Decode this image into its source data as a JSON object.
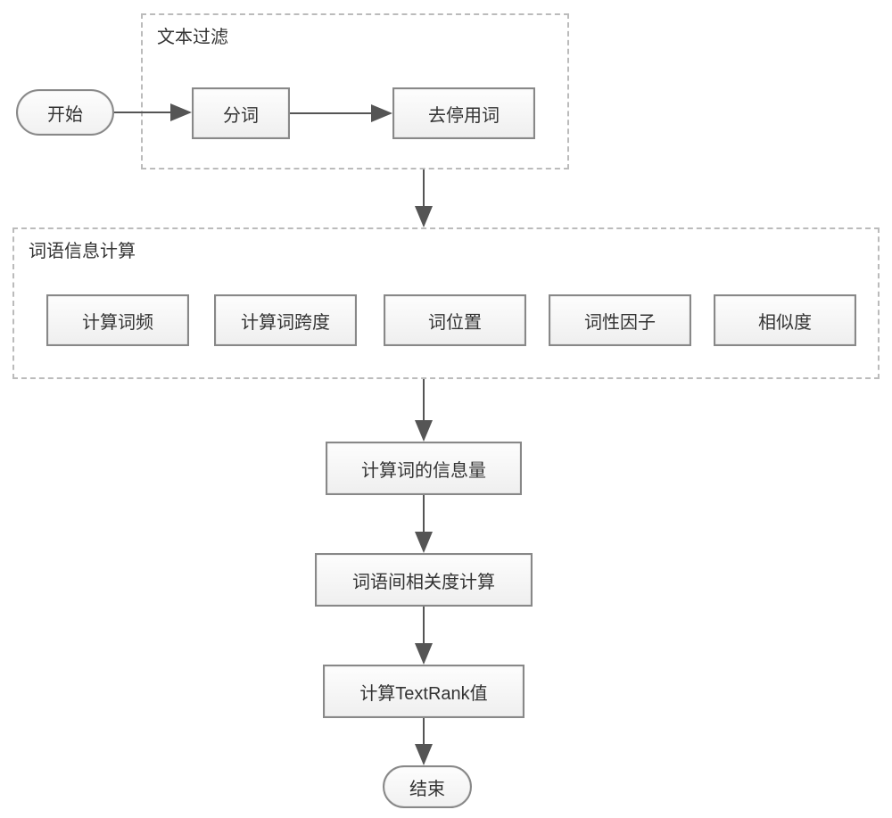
{
  "chart_data": {
    "type": "flowchart",
    "title": "",
    "nodes": [
      {
        "id": "start",
        "kind": "terminator",
        "label": "开始"
      },
      {
        "id": "g_filter",
        "kind": "group",
        "label": "文本过滤",
        "children": [
          "tokenize",
          "stopwords"
        ]
      },
      {
        "id": "tokenize",
        "kind": "process",
        "label": "分词"
      },
      {
        "id": "stopwords",
        "kind": "process",
        "label": "去停用词"
      },
      {
        "id": "g_info",
        "kind": "group",
        "label": "词语信息计算",
        "children": [
          "tf",
          "span",
          "pos",
          "posf",
          "sim"
        ]
      },
      {
        "id": "tf",
        "kind": "process",
        "label": "计算词频"
      },
      {
        "id": "span",
        "kind": "process",
        "label": "计算词跨度"
      },
      {
        "id": "pos",
        "kind": "process",
        "label": "词位置"
      },
      {
        "id": "posf",
        "kind": "process",
        "label": "词性因子"
      },
      {
        "id": "sim",
        "kind": "process",
        "label": "相似度"
      },
      {
        "id": "infoamt",
        "kind": "process",
        "label": "计算词的信息量"
      },
      {
        "id": "rel",
        "kind": "process",
        "label": "词语间相关度计算"
      },
      {
        "id": "textrank",
        "kind": "process",
        "label": "计算TextRank值"
      },
      {
        "id": "end",
        "kind": "terminator",
        "label": "结束"
      }
    ],
    "edges": [
      {
        "from": "start",
        "to": "tokenize"
      },
      {
        "from": "tokenize",
        "to": "stopwords"
      },
      {
        "from": "g_filter",
        "to": "g_info"
      },
      {
        "from": "g_info",
        "to": "infoamt"
      },
      {
        "from": "infoamt",
        "to": "rel"
      },
      {
        "from": "rel",
        "to": "textrank"
      },
      {
        "from": "textrank",
        "to": "end"
      }
    ]
  },
  "nodes": {
    "start": "开始",
    "g_filter": "文本过滤",
    "tokenize": "分词",
    "stopwords": "去停用词",
    "g_info": "词语信息计算",
    "tf": "计算词频",
    "span": "计算词跨度",
    "pos": "词位置",
    "posf": "词性因子",
    "sim": "相似度",
    "infoamt": "计算词的信息量",
    "rel": "词语间相关度计算",
    "textrank": "计算TextRank值",
    "end": "结束"
  }
}
